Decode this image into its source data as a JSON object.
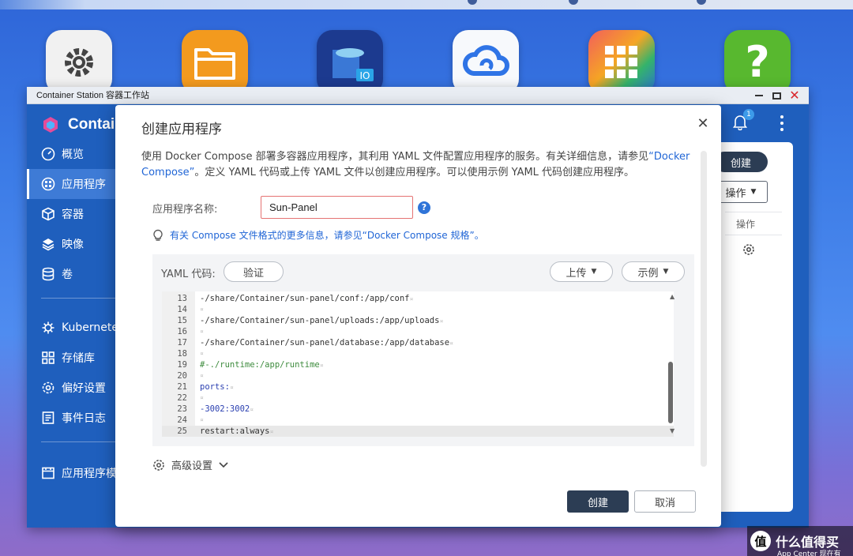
{
  "window": {
    "title": "Container Station 容器工作站",
    "brand": "Contai"
  },
  "sidebar": {
    "items": [
      {
        "label": "概览",
        "icon": "gauge-icon"
      },
      {
        "label": "应用程序",
        "icon": "apps-icon"
      },
      {
        "label": "容器",
        "icon": "cube-icon"
      },
      {
        "label": "映像",
        "icon": "layers-icon"
      },
      {
        "label": "卷",
        "icon": "database-icon"
      },
      {
        "label": "Kubernete",
        "icon": "helm-icon"
      },
      {
        "label": "存储库",
        "icon": "grid-icon"
      },
      {
        "label": "偏好设置",
        "icon": "gear-icon"
      },
      {
        "label": "事件日志",
        "icon": "log-icon"
      },
      {
        "label": "应用程序模",
        "icon": "template-icon"
      }
    ]
  },
  "background_panel": {
    "create_label": "创建",
    "actions_label": "操作",
    "column_header": "操作",
    "notification_count": "1"
  },
  "dialog": {
    "title": "创建应用程序",
    "intro_prefix": "使用 Docker Compose 部署多容器应用程序，其利用 YAML 文件配置应用程序的服务。有关详细信息，请参见",
    "intro_link": "“Docker Compose”",
    "intro_suffix": "。定义 YAML 代码或上传 YAML 文件以创建应用程序。可以使用示例 YAML 代码创建应用程序。",
    "name_label": "应用程序名称:",
    "name_value": "Sun-Panel",
    "help_symbol": "?",
    "tip_text": "有关 Compose 文件格式的更多信息，请参见“Docker Compose 规格”。",
    "yaml_label": "YAML 代码:",
    "validate_label": "验证",
    "upload_label": "上传",
    "example_label": "示例",
    "code_lines": [
      {
        "n": "13",
        "text": "-/share/Container/sun-panel/conf:/app/conf"
      },
      {
        "n": "14",
        "text": ""
      },
      {
        "n": "15",
        "text": "-/share/Container/sun-panel/uploads:/app/uploads"
      },
      {
        "n": "16",
        "text": ""
      },
      {
        "n": "17",
        "text": "-/share/Container/sun-panel/database:/app/database"
      },
      {
        "n": "18",
        "text": ""
      },
      {
        "n": "19",
        "text": "#-./runtime:/app/runtime"
      },
      {
        "n": "20",
        "text": ""
      },
      {
        "n": "21",
        "text": "ports:"
      },
      {
        "n": "22",
        "text": ""
      },
      {
        "n": "23",
        "text": "-3002:3002"
      },
      {
        "n": "24",
        "text": ""
      },
      {
        "n": "25",
        "text": "restart:always"
      }
    ],
    "advanced_label": "高级设置",
    "create_button": "创建",
    "cancel_button": "取消"
  },
  "watermark": {
    "text": "什么值得买",
    "subtext": "App Center 现在有"
  },
  "colors": {
    "accent": "#1f5fbd",
    "link": "#2166d6",
    "primary_button": "#2c3d54",
    "input_error_border": "#e57373"
  }
}
